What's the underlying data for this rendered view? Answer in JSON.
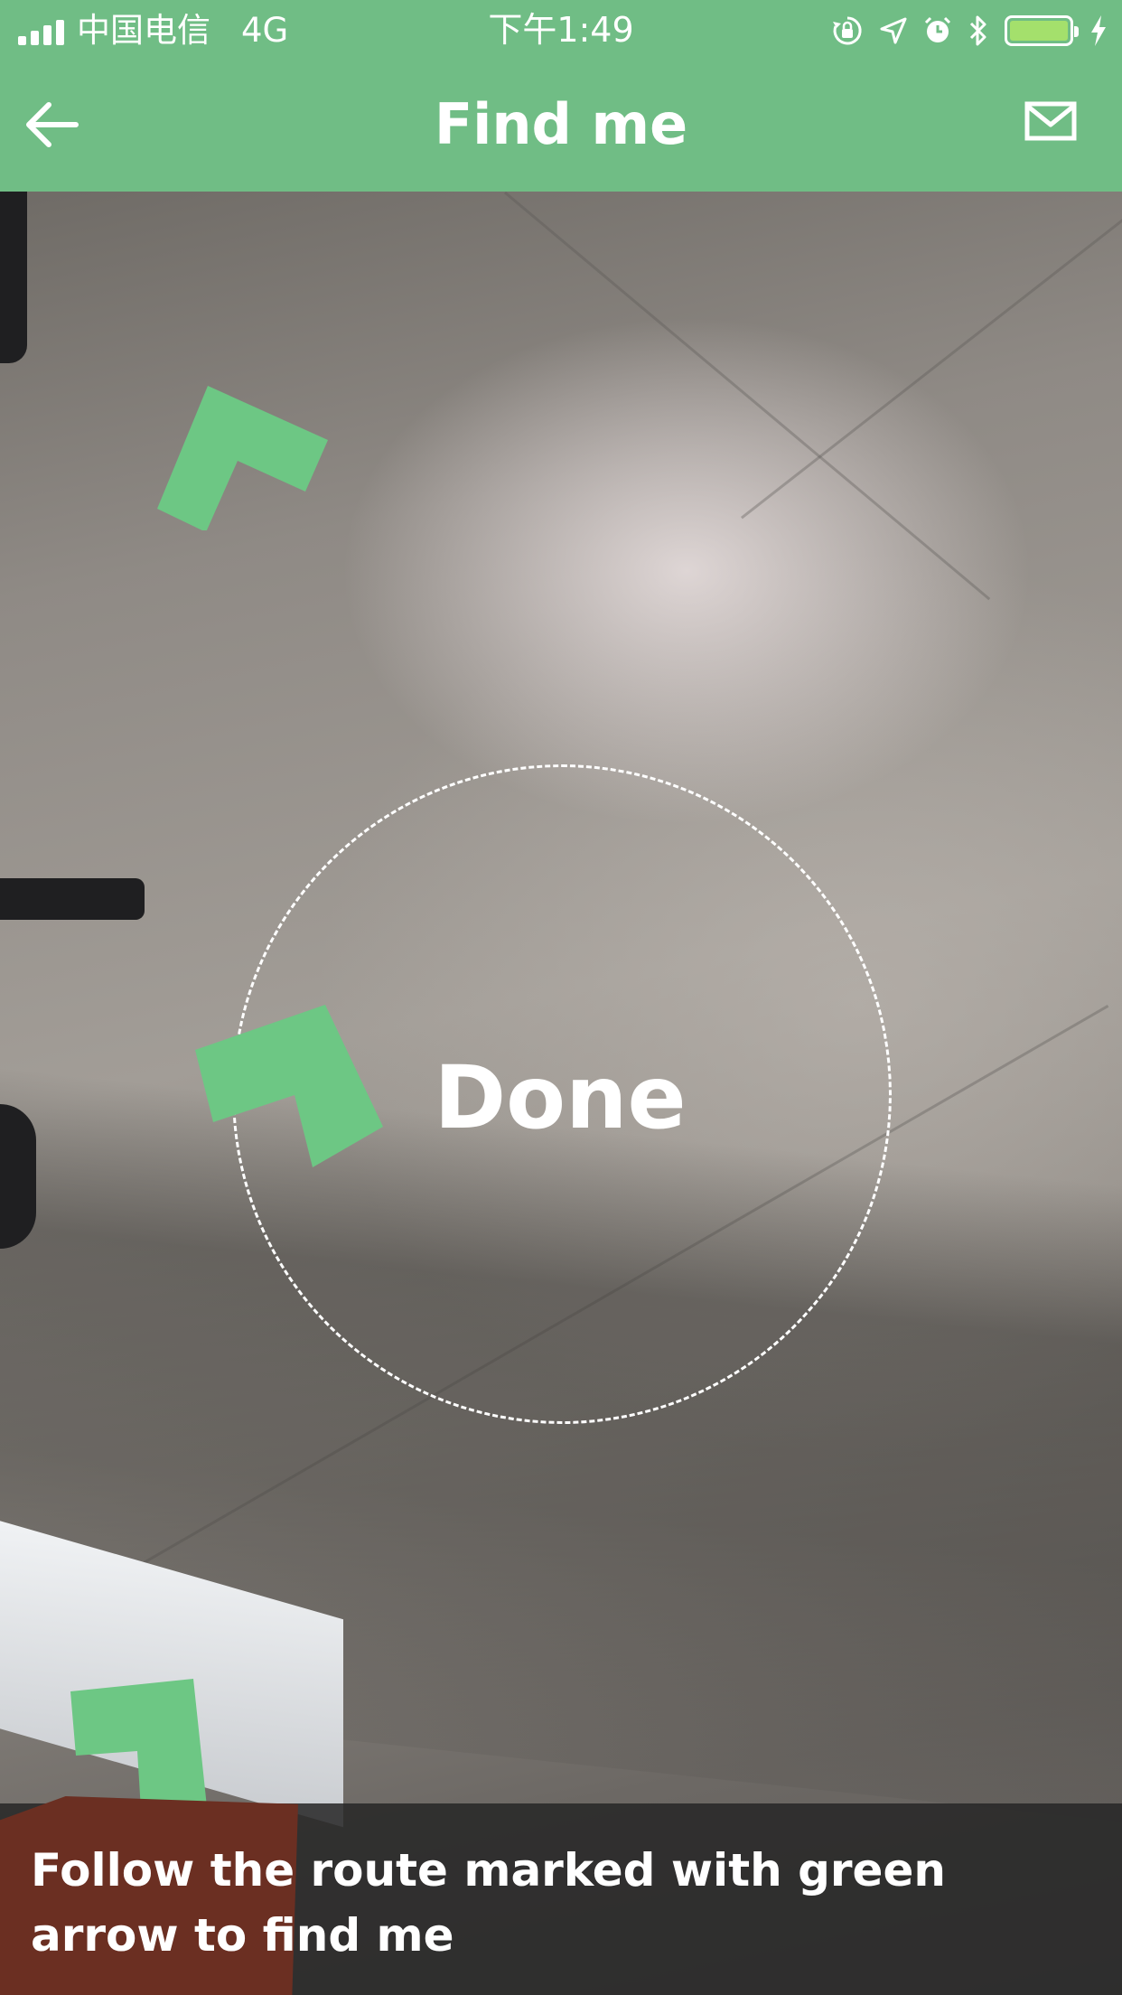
{
  "status_bar": {
    "carrier": "中国电信",
    "network": "4G",
    "time": "下午1:49",
    "icons": [
      "rotation-lock-icon",
      "location-arrow-icon",
      "alarm-icon",
      "bluetooth-icon",
      "battery-icon",
      "charging-icon"
    ],
    "battery_level": 1.0
  },
  "nav": {
    "title": "Find me",
    "back_icon": "back-arrow-icon",
    "mail_icon": "mail-icon"
  },
  "camera": {
    "center_label": "Done"
  },
  "banner": {
    "text": "Follow the route marked with green arrow to find me"
  },
  "colors": {
    "brand_green": "#70bd85",
    "arrow_green": "#6dc784",
    "banner_bg": "#262626"
  }
}
